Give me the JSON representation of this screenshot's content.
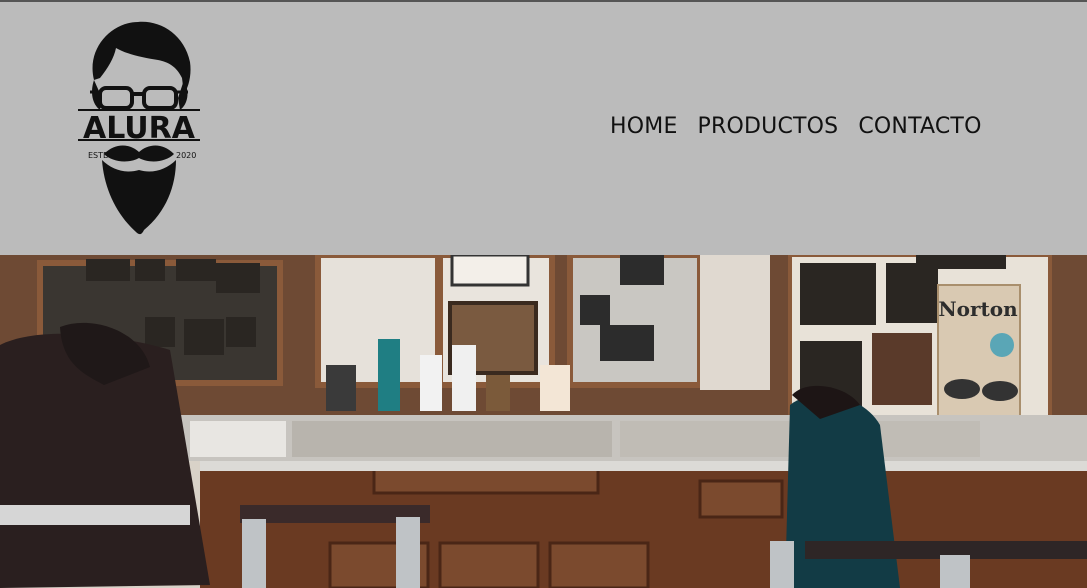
{
  "logo": {
    "name": "ALURA",
    "established_left": "ESTD",
    "established_right": "2020"
  },
  "nav": {
    "items": [
      "HOME",
      "PRODUCTOS",
      "CONTACTO"
    ]
  },
  "banner": {
    "sign_text": "Norton"
  }
}
